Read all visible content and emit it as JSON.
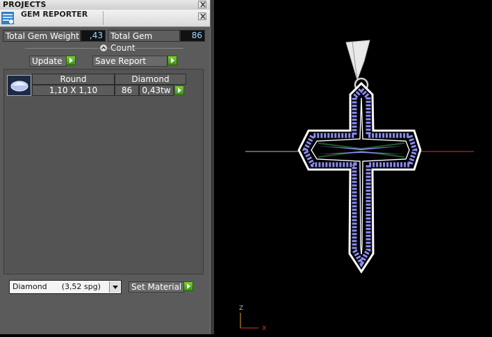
{
  "projects": {
    "title": "PROJECTS"
  },
  "gem_reporter": {
    "title": "GEM REPORTER",
    "total_weight_label": "Total Gem Weight",
    "total_weight_value": ",43",
    "total_count_label": "Total Gem Count",
    "total_count_value": "86",
    "update_label": "Update",
    "save_report_label": "Save Report",
    "table": {
      "headers": [
        "Round",
        "Diamond"
      ],
      "rows": [
        {
          "size": "1,10 X 1,10",
          "count": "86",
          "weight": "0,43tw"
        }
      ]
    },
    "material_select": "Diamond      (3,52 spg)",
    "set_material_label": "Set Material"
  },
  "viewport": {
    "axis_z": "Z",
    "axis_x": "X"
  },
  "colors": {
    "panel_bg": "#5b5b5b",
    "gem": "#8a8aee",
    "play_button": "#5cae2a",
    "axis_x": "#d23a2a"
  }
}
